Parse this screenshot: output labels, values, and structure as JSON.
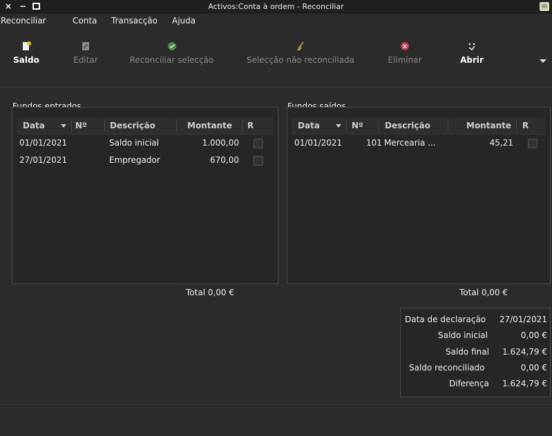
{
  "window": {
    "title": "Activos:Conta à ordem - Reconciliar",
    "controls": {
      "close": "×",
      "minimize": "−"
    }
  },
  "menubar": {
    "items": [
      "Reconciliar",
      "Conta",
      "Transacção",
      "Ajuda"
    ]
  },
  "toolbar": {
    "buttons": [
      {
        "label": "Saldo",
        "icon": "new-document-icon",
        "enabled": true
      },
      {
        "label": "Editar",
        "icon": "edit-document-icon",
        "enabled": false
      },
      {
        "label": "Reconciliar selecção",
        "icon": "check-circle-icon",
        "enabled": false
      },
      {
        "label": "Selecção não reconciliada",
        "icon": "broom-icon",
        "enabled": false
      },
      {
        "label": "Eliminar",
        "icon": "delete-circle-icon",
        "enabled": false
      },
      {
        "label": "Abrir",
        "icon": "sparkle-icon",
        "enabled": true
      }
    ]
  },
  "funds_in": {
    "label": "Fundos entrados",
    "columns": {
      "date": "Data",
      "num": "Nº",
      "desc": "Descrição",
      "amount": "Montante",
      "r": "R"
    },
    "rows": [
      {
        "date": "01/01/2021",
        "num": "",
        "desc": "Saldo inicial",
        "amount": "1.000,00",
        "reconciled": false
      },
      {
        "date": "27/01/2021",
        "num": "",
        "desc": "Empregador",
        "amount": "670,00",
        "reconciled": false
      }
    ],
    "total": "Total 0,00 €"
  },
  "funds_out": {
    "label": "Fundos saídos",
    "columns": {
      "date": "Data",
      "num": "Nº",
      "desc": "Descrição",
      "amount": "Montante",
      "r": "R"
    },
    "rows": [
      {
        "date": "01/01/2021",
        "num": "101",
        "desc": "Mercearia ...",
        "amount": "45,21",
        "reconciled": false
      }
    ],
    "total": "Total 0,00 €"
  },
  "summary": {
    "statement_date_label": "Data de declaração",
    "statement_date": "27/01/2021",
    "opening_label": "Saldo inicial",
    "opening": "0,00 €",
    "ending_label": "Saldo final",
    "ending": "1.624,79 €",
    "reconciled_label": "Saldo reconciliado",
    "reconciled": "0,00 €",
    "difference_label": "Diferença",
    "difference": "1.624,79 €"
  }
}
